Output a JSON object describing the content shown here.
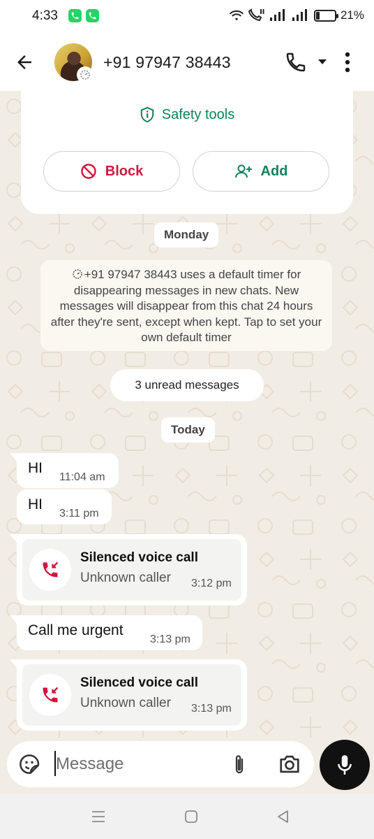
{
  "status_bar": {
    "time": "4:33",
    "battery_percent": "21%",
    "battery_level": 0.21,
    "icons": [
      "whatsapp-icon",
      "whatsapp-icon",
      "wifi-icon",
      "wifi-call-icon",
      "signal-icon",
      "signal-icon",
      "battery-icon"
    ]
  },
  "header": {
    "contact_name": "+91 97947 38443",
    "icons": [
      "back-arrow-icon",
      "avatar",
      "timer-icon",
      "phone-icon",
      "chevron-down-icon",
      "more-vert-icon"
    ]
  },
  "safety_card": {
    "title": "Safety tools",
    "block_label": "Block",
    "add_label": "Add"
  },
  "chips": {
    "monday": "Monday",
    "today": "Today",
    "unread": "3 unread messages"
  },
  "system_note": {
    "text": "+91 97947 38443 uses a default timer for disappearing messages in new chats. New messages will disappear from this chat 24 hours after they're sent, except when kept. Tap to set your own default timer"
  },
  "messages": [
    {
      "type": "text",
      "text": "HI",
      "time": "11:04 am"
    },
    {
      "type": "text",
      "text": "HI",
      "time": "3:11 pm"
    },
    {
      "type": "call",
      "title": "Silenced voice call",
      "subtitle": "Unknown caller",
      "time": "3:12 pm"
    },
    {
      "type": "text",
      "text": "Call me urgent",
      "time": "3:13 pm"
    },
    {
      "type": "call",
      "title": "Silenced voice call",
      "subtitle": "Unknown caller",
      "time": "3:13 pm"
    }
  ],
  "composer": {
    "placeholder": "Message"
  },
  "colors": {
    "accent_green": "#12805c",
    "block_red": "#d0163f",
    "wallpaper": "#f1ece4",
    "missed_call_red": "#d0163f"
  }
}
